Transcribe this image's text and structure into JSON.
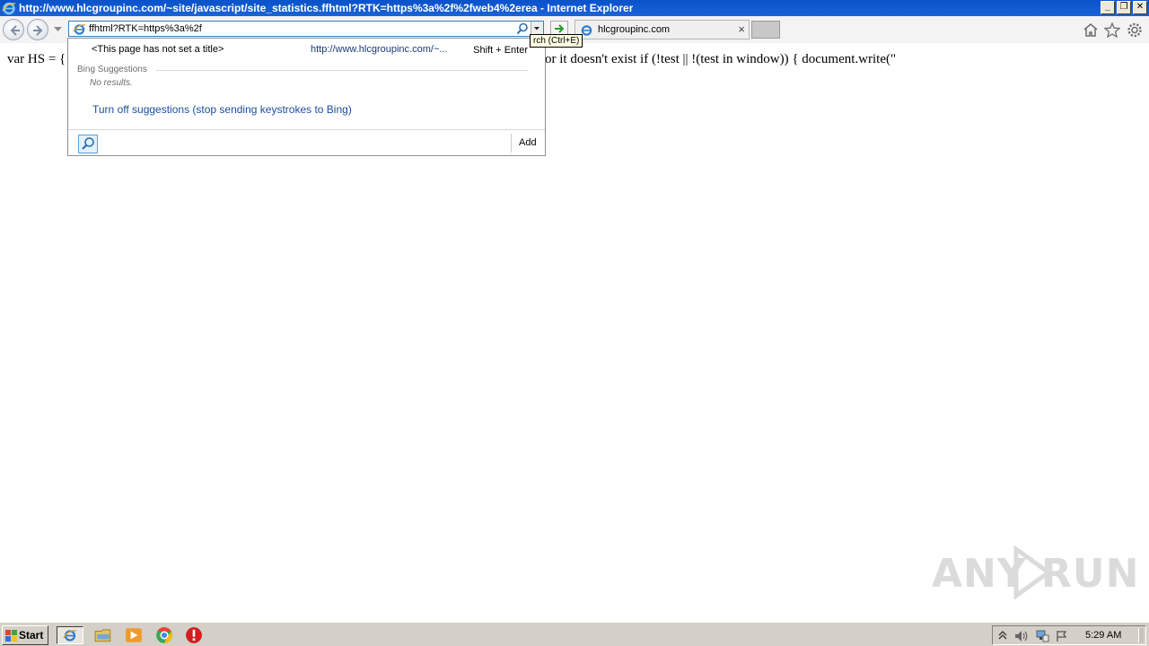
{
  "window": {
    "title": "http://www.hlcgroupinc.com/~site/javascript/site_statistics.ffhtml?RTK=https%3a%2f%2fweb4%2erea - Internet Explorer",
    "controls": [
      "minimize",
      "restore",
      "close"
    ]
  },
  "navbar": {
    "address_value": "ffhtml?RTK=https%3a%2f",
    "tab_label": "hlcgroupinc.com",
    "tab_close": "×",
    "tooltip": "rch (Ctrl+E)",
    "icons": [
      "back-icon",
      "forward-icon",
      "home-icon",
      "favorites-star-icon",
      "tools-gear-icon"
    ]
  },
  "page": {
    "text_left": "var HS = {",
    "text_right": "or it doesn't exist if (!test || !(test in window)) { document.write(\""
  },
  "suggestions": {
    "history_item_title": "<This page has not set a title>",
    "history_item_url": "http://www.hlcgroupinc.com/~...",
    "history_item_shortcut": "Shift + Enter",
    "bing_header": "Bing Suggestions",
    "no_results": "No results.",
    "turn_off_link": "Turn off suggestions (stop sending keystrokes to Bing)",
    "add_label": "Add"
  },
  "watermark": {
    "left": "ANY",
    "right": "RUN"
  },
  "taskbar": {
    "start_label": "Start",
    "clock": "5:29 AM",
    "apps": [
      "internet-explorer-icon",
      "file-explorer-icon",
      "media-player-icon",
      "chrome-icon",
      "stop-icon"
    ]
  }
}
